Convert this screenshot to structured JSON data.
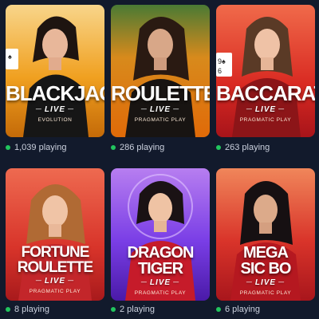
{
  "games": [
    {
      "title_lines": [
        "BLACKJACK"
      ],
      "live": "LIVE",
      "provider": "EVOLUTION",
      "players": "1,039 playing",
      "accent": "#f2a31c"
    },
    {
      "title_lines": [
        "ROULETTE"
      ],
      "live": "LIVE",
      "provider": "PRAGMATIC PLAY",
      "players": "286 playing",
      "accent": "#f08a1a"
    },
    {
      "title_lines": [
        "BACCARAT"
      ],
      "live": "LIVE",
      "provider": "PRAGMATIC PLAY",
      "players": "263 playing",
      "accent": "#d72a24"
    },
    {
      "title_lines": [
        "FORTUNE",
        "ROULETTE"
      ],
      "live": "LIVE",
      "provider": "PRAGMATIC PLAY",
      "players": "8 playing",
      "accent": "#d63a2c"
    },
    {
      "title_lines": [
        "DRAGON",
        "TIGER"
      ],
      "live": "LIVE",
      "provider": "PRAGMATIC PLAY",
      "players": "2 playing",
      "accent": "#7a3ee6"
    },
    {
      "title_lines": [
        "MEGA",
        "SIC BO"
      ],
      "live": "LIVE",
      "provider": "PRAGMATIC PLAY",
      "players": "6 playing",
      "accent": "#d9342a"
    }
  ],
  "colors": {
    "background": "#121a2c",
    "online_dot": "#22c55e",
    "count_text": "#cbd1de"
  }
}
